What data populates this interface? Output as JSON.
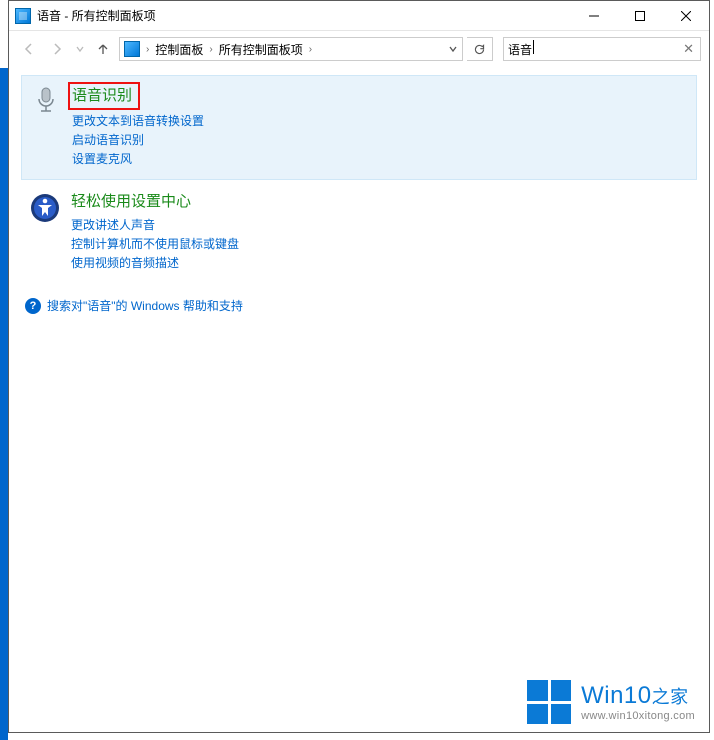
{
  "window": {
    "title": "语音 - 所有控制面板项"
  },
  "breadcrumb": {
    "level1": "控制面板",
    "level2": "所有控制面板项"
  },
  "search": {
    "value": "语音"
  },
  "results": {
    "speech": {
      "title": "语音识别",
      "link1": "更改文本到语音转换设置",
      "link2": "启动语音识别",
      "link3": "设置麦克风"
    },
    "ease": {
      "title": "轻松使用设置中心",
      "link1": "更改讲述人声音",
      "link2": "控制计算机而不使用鼠标或键盘",
      "link3": "使用视频的音频描述"
    }
  },
  "help": {
    "text": "搜索对\"语音\"的 Windows 帮助和支持"
  },
  "watermark": {
    "title_a": "Win10",
    "title_b": "之家",
    "url": "www.win10xitong.com"
  }
}
